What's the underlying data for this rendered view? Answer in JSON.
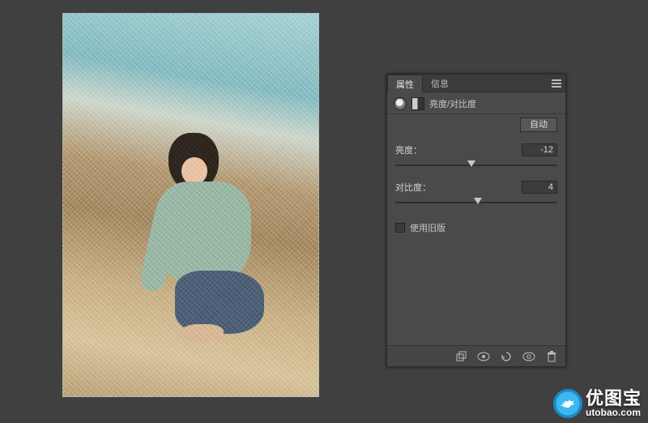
{
  "panel": {
    "tabs": [
      "属性",
      "信息"
    ],
    "active_tab_index": 0,
    "adjustment_title": "亮度/对比度",
    "auto_label": "自动",
    "controls": {
      "brightness": {
        "label": "亮度：",
        "value": "-12",
        "thumb_pct": 47
      },
      "contrast": {
        "label": "对比度：",
        "value": "4",
        "thumb_pct": 51
      }
    },
    "legacy_label": "使用旧版",
    "legacy_checked": false
  },
  "watermark": {
    "name_zh": "优图宝",
    "name_en": "utobao.com"
  }
}
